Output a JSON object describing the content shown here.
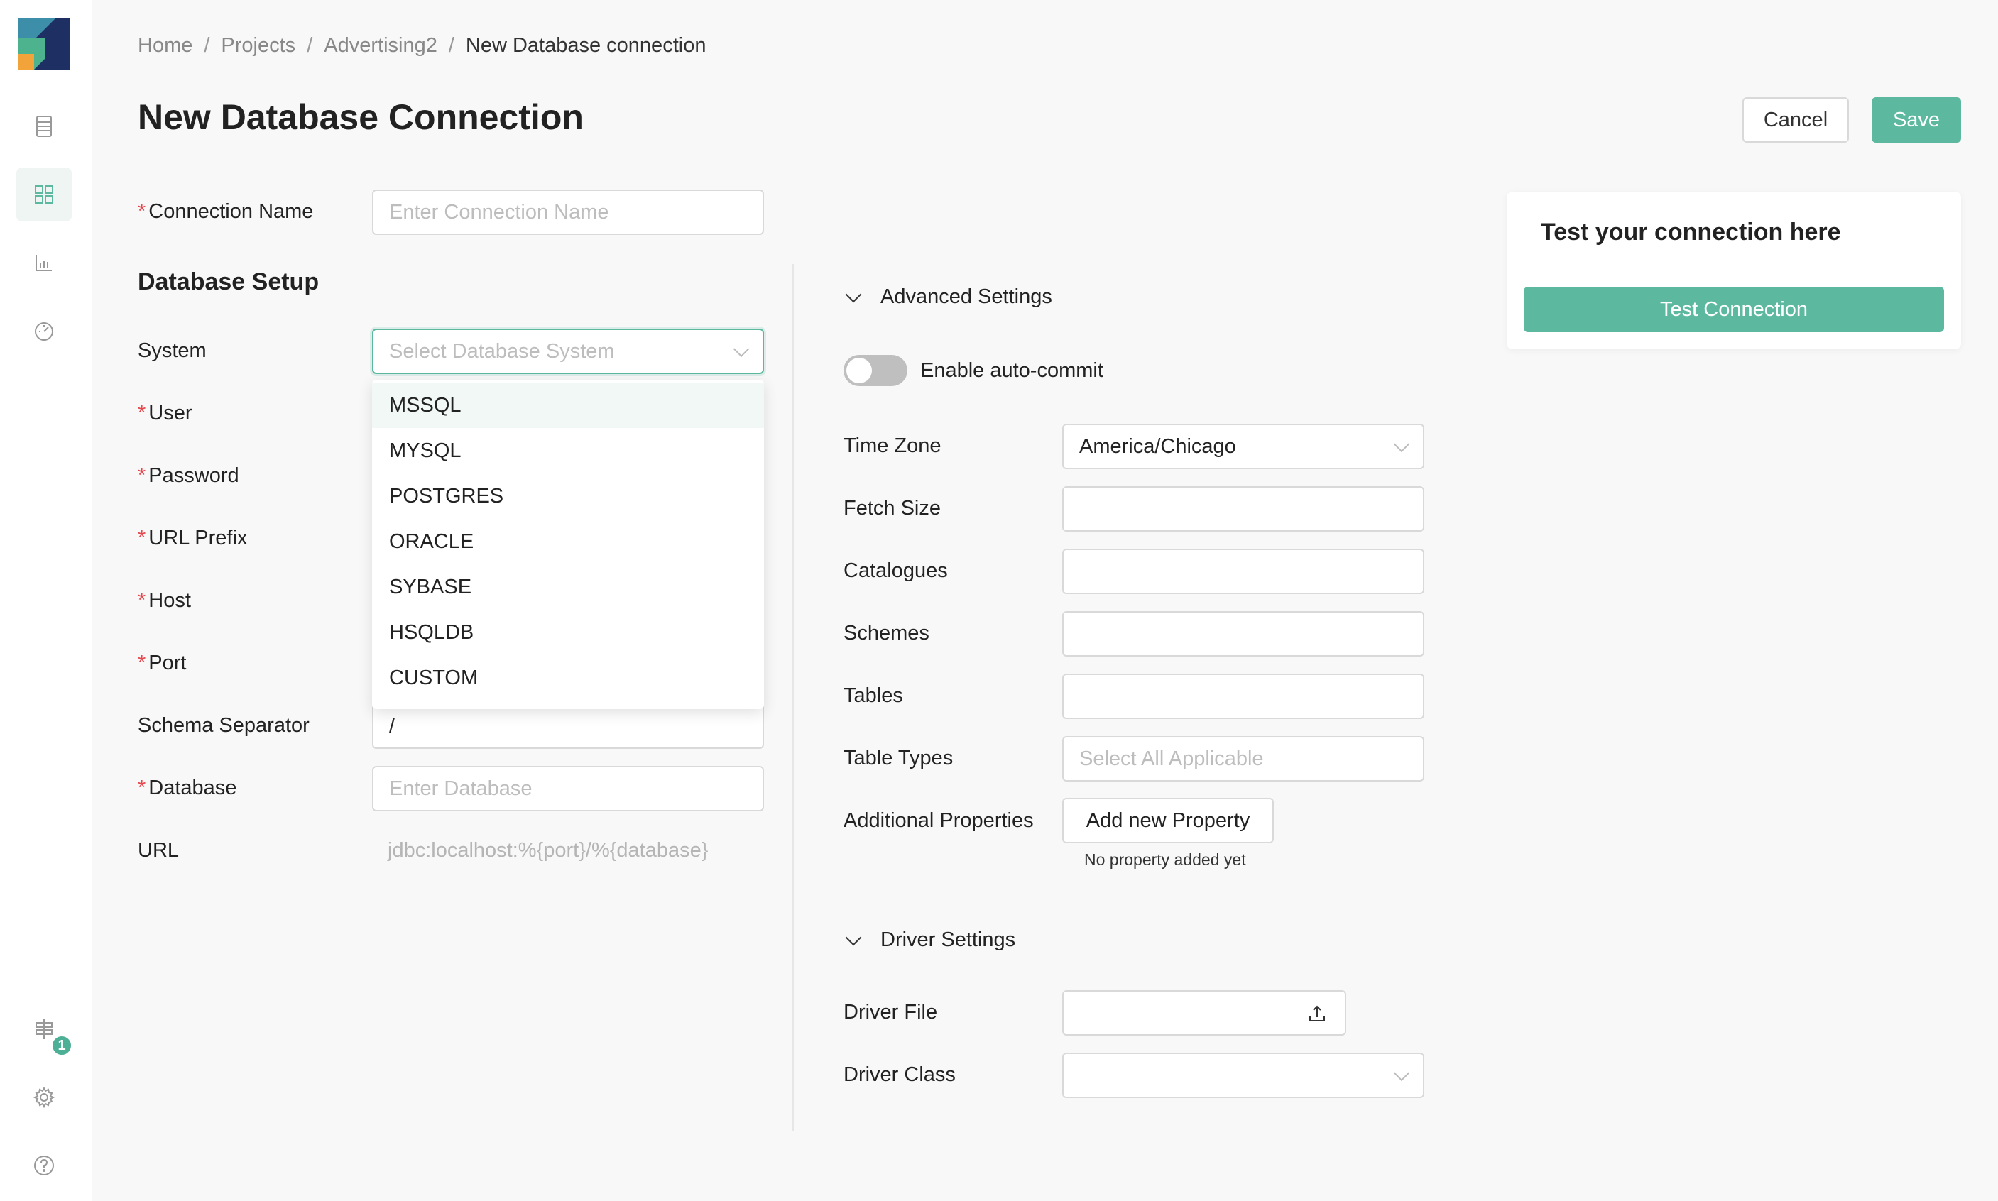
{
  "breadcrumb": [
    "Home",
    "Projects",
    "Advertising2",
    "New Database connection"
  ],
  "page_title": "New Database Connection",
  "actions": {
    "cancel": "Cancel",
    "save": "Save"
  },
  "form": {
    "connection_name": {
      "label": "Connection Name",
      "placeholder": "Enter Connection Name"
    },
    "db_setup_title": "Database Setup",
    "system": {
      "label": "System",
      "placeholder": "Select Database System"
    },
    "user": {
      "label": "User"
    },
    "password": {
      "label": "Password"
    },
    "url_prefix": {
      "label": "URL Prefix"
    },
    "host": {
      "label": "Host"
    },
    "port": {
      "label": "Port"
    },
    "schema_separator": {
      "label": "Schema Separator",
      "value": "/"
    },
    "database": {
      "label": "Database",
      "placeholder": "Enter Database"
    },
    "url": {
      "label": "URL",
      "value": "jdbc:localhost:%{port}/%{database}"
    }
  },
  "system_options": [
    "MSSQL",
    "MYSQL",
    "POSTGRES",
    "ORACLE",
    "SYBASE",
    "HSQLDB",
    "CUSTOM"
  ],
  "advanced": {
    "title": "Advanced Settings",
    "auto_commit": "Enable auto-commit",
    "auto_commit_on": false,
    "time_zone": {
      "label": "Time Zone",
      "value": "America/Chicago"
    },
    "fetch_size": {
      "label": "Fetch Size"
    },
    "catalogues": {
      "label": "Catalogues"
    },
    "schemes": {
      "label": "Schemes"
    },
    "tables": {
      "label": "Tables"
    },
    "table_types": {
      "label": "Table Types",
      "placeholder": "Select All Applicable"
    },
    "additional_properties": {
      "label": "Additional Properties",
      "button": "Add new Property",
      "note": "No property added yet"
    }
  },
  "driver": {
    "title": "Driver Settings",
    "driver_file": {
      "label": "Driver File"
    },
    "driver_class": {
      "label": "Driver Class"
    }
  },
  "test": {
    "title": "Test your connection here",
    "button": "Test Connection"
  },
  "sidebar": {
    "notification_count": "1"
  },
  "colors": {
    "accent": "#5cb89f",
    "required": "#e5484d"
  }
}
